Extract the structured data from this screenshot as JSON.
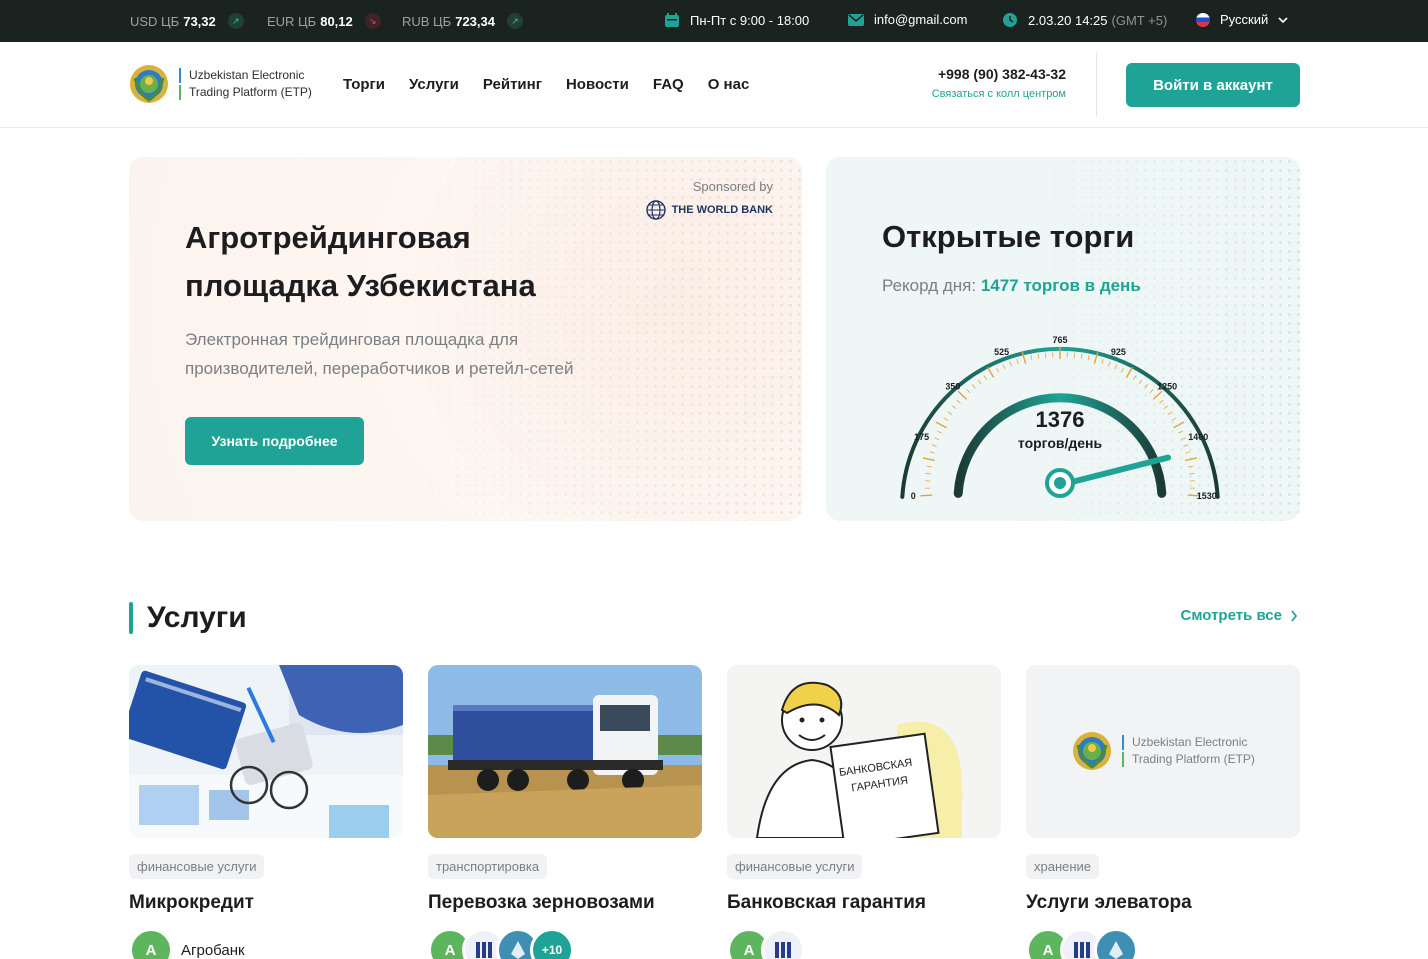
{
  "topbar": {
    "currencies": [
      {
        "label": "USD ЦБ",
        "value": "73,32",
        "trend": "up"
      },
      {
        "label": "EUR ЦБ",
        "value": "80,12",
        "trend": "down"
      },
      {
        "label": "RUB ЦБ",
        "value": "723,34",
        "trend": "up"
      }
    ],
    "hours": "Пн-Пт с 9:00 - 18:00",
    "email": "info@gmail.com",
    "datetime": "2.03.20 14:25",
    "timezone": "(GMT +5)",
    "language": "Русский"
  },
  "header": {
    "logo_line1": "Uzbekistan Electronic",
    "logo_line2": "Trading Platform (ETP)",
    "nav": [
      "Торги",
      "Услуги",
      "Рейтинг",
      "Новости",
      "FAQ",
      "О нас"
    ],
    "phone": "+998 (90) 382-43-32",
    "call_center": "Связаться с колл центром",
    "login": "Войти в аккаунт"
  },
  "hero": {
    "sponsored_by": "Sponsored by",
    "sponsor_name": "THE WORLD BANK",
    "title_line1": "Агротрейдинговая",
    "title_line2": "площадка Узбекистана",
    "desc_line1": "Электронная трейдинговая площадка для",
    "desc_line2": "производителей, переработчиков и ретейл-сетей",
    "button": "Узнать подробнее"
  },
  "open_trades": {
    "title": "Открытые торги",
    "record_label": "Рекорд дня:",
    "record_value": "1477 торгов в день",
    "gauge": {
      "value": 1376,
      "unit": "торгов/день",
      "ticks": [
        "0",
        "175",
        "350",
        "525",
        "765",
        "925",
        "1250",
        "1400",
        "1530"
      ],
      "max": 1530
    }
  },
  "services": {
    "title": "Услуги",
    "see_all": "Смотреть все",
    "cards": [
      {
        "tag": "финансовые услуги",
        "title": "Микрокредит",
        "provider": "Агробанк"
      },
      {
        "tag": "транспортировка",
        "title": "Перевозка зерновозами",
        "more": "+10"
      },
      {
        "tag": "финансовые услуги",
        "title": "Банковская гарантия",
        "image_text_1": "БАНКОВСКАЯ",
        "image_text_2": "ГАРАНТИЯ"
      },
      {
        "tag": "хранение",
        "title": "Услуги элеватора",
        "logo_line1": "Uzbekistan Electronic",
        "logo_line2": "Trading Platform (ETP)"
      }
    ]
  },
  "colors": {
    "accent": "#1fa396",
    "dark": "#1b2320",
    "up": "#2bc49a",
    "down": "#e0494f"
  }
}
